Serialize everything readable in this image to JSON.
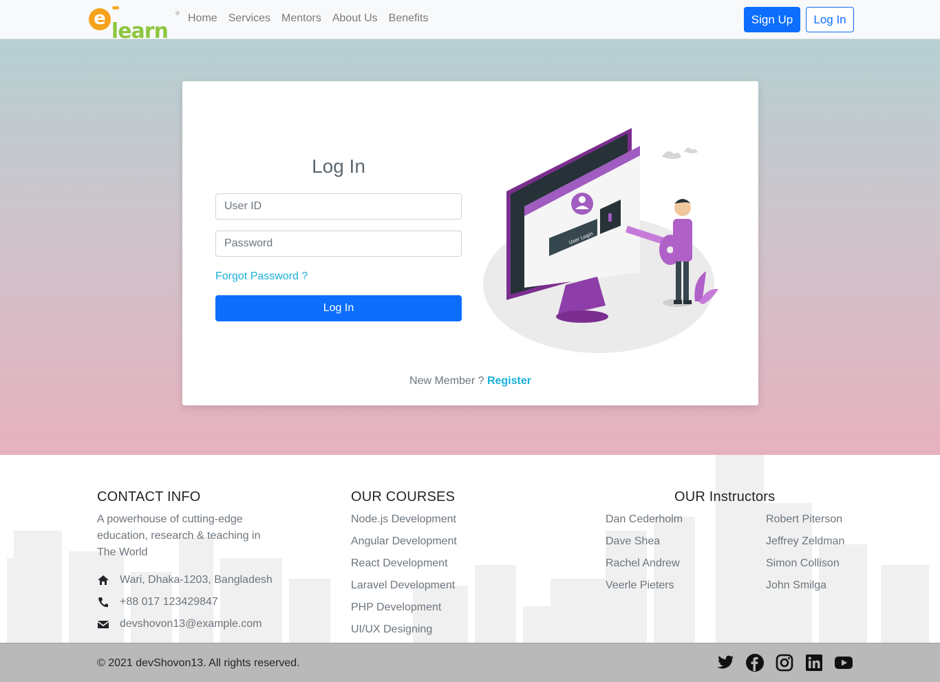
{
  "nav": {
    "logo": {
      "letter": "e",
      "text": "learn",
      "tm": "®"
    },
    "links": [
      "Home",
      "Services",
      "Mentors",
      "About Us",
      "Benefits"
    ],
    "signup_label": "Sign Up",
    "login_label": "Log In"
  },
  "login": {
    "title": "Log In",
    "user_placeholder": "User ID",
    "password_placeholder": "Password",
    "forgot_label": "Forgot Password ?",
    "submit_label": "Log In",
    "illustration_text": "User Login",
    "new_member_text": "New Member ?",
    "register_label": "Register"
  },
  "footer": {
    "contact": {
      "heading": "CONTACT INFO",
      "description": "A powerhouse of cutting-edge education, research & teaching in The World",
      "address": "Wari, Dhaka-1203, Bangladesh",
      "phone": "+88 017 123429847",
      "email": "devshovon13@example.com"
    },
    "courses": {
      "heading": "OUR COURSES",
      "items": [
        "Node.js Development",
        "Angular Development",
        "React Development",
        "Laravel Development",
        "PHP Development",
        "UI/UX Designing"
      ]
    },
    "instructors": {
      "heading": "OUR Instructors",
      "items": [
        "Dan Cederholm",
        "Robert Piterson",
        "Dave Shea",
        "Jeffrey Zeldman",
        "Rachel Andrew",
        "Simon Collison",
        "Veerle Pieters",
        "John Smilga"
      ]
    },
    "copyright": "© 2021 devShovon13. All rights reserved.",
    "socials": [
      "twitter-icon",
      "facebook-icon",
      "instagram-icon",
      "linkedin-icon",
      "youtube-icon"
    ]
  },
  "colors": {
    "primary": "#0d6efd",
    "link_cyan": "#17b0d9",
    "logo_orange": "#f5a21c",
    "logo_green": "#8dc63f",
    "illustration_purple": "#9b59b6"
  }
}
